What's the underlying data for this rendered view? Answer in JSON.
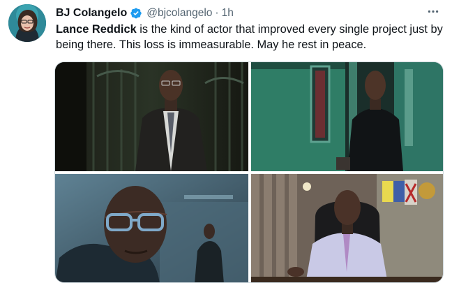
{
  "tweet": {
    "author": {
      "display_name": "BJ Colangelo",
      "handle": "@bjcolangelo",
      "verified": true
    },
    "separator": "·",
    "timestamp": "1h",
    "text": {
      "bold_lead": "Lance Reddick",
      "rest": " is the kind of actor that improved every single project just by being there. This loss is immeasurable. May he rest in peace."
    },
    "icons": {
      "verified": "verified-badge-icon",
      "more": "more-options-icon"
    },
    "media": {
      "count": 4,
      "photos": [
        "photo-1",
        "photo-2",
        "photo-3",
        "photo-4"
      ]
    },
    "colors": {
      "verified_blue": "#1d9bf0",
      "secondary_text": "#536471",
      "primary_text": "#0f1419"
    }
  }
}
